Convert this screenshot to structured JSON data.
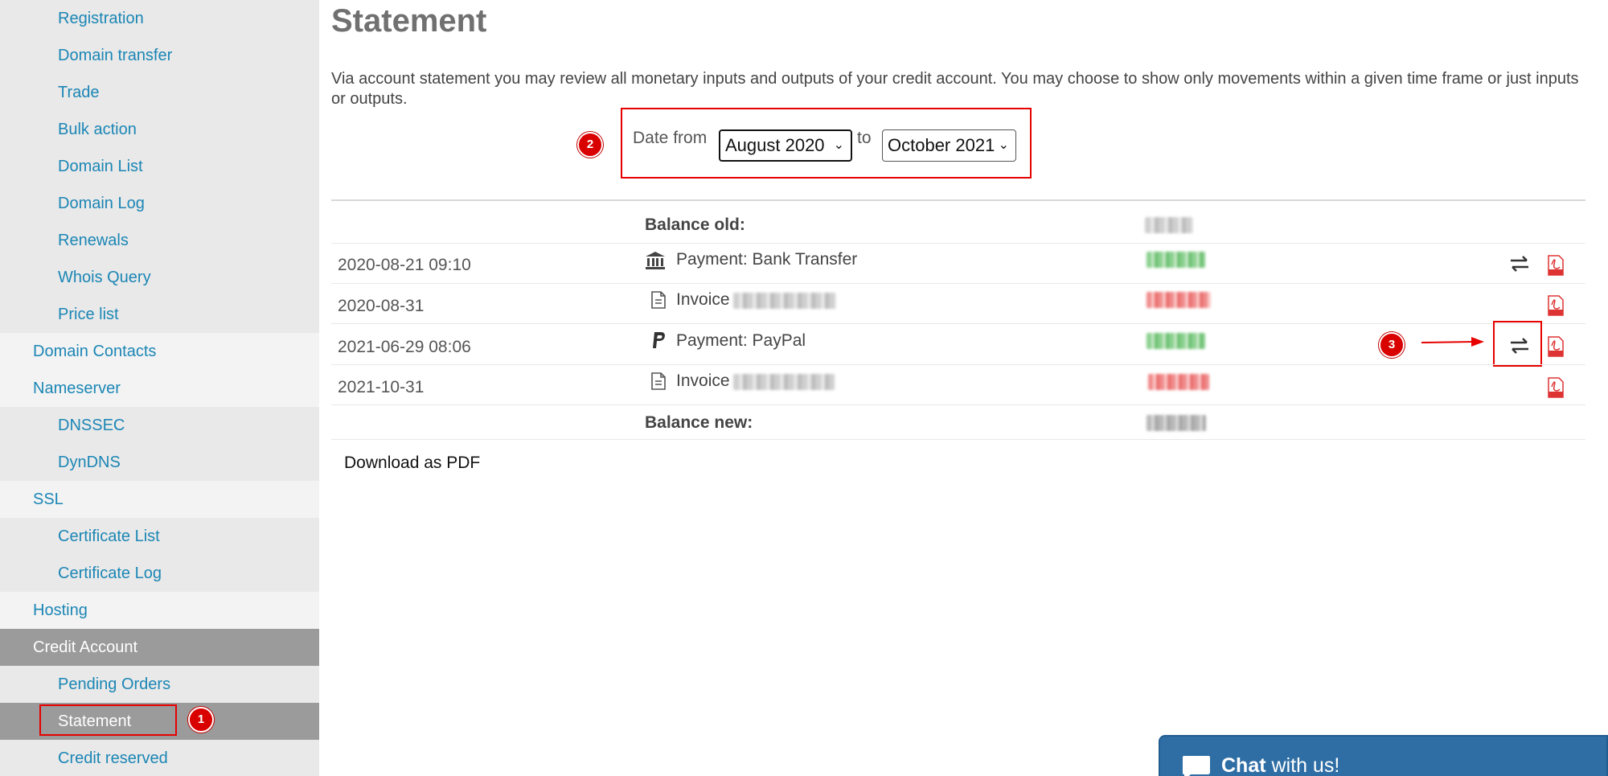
{
  "sidebar": {
    "items": [
      {
        "label": "Registration"
      },
      {
        "label": "Domain transfer"
      },
      {
        "label": "Trade"
      },
      {
        "label": "Bulk action"
      },
      {
        "label": "Domain List"
      },
      {
        "label": "Domain Log"
      },
      {
        "label": "Renewals"
      },
      {
        "label": "Whois Query"
      },
      {
        "label": "Price list"
      },
      {
        "label": "Domain Contacts"
      },
      {
        "label": "Nameserver"
      },
      {
        "label": "DNSSEC"
      },
      {
        "label": "DynDNS"
      },
      {
        "label": "SSL"
      },
      {
        "label": "Certificate List"
      },
      {
        "label": "Certificate Log"
      },
      {
        "label": "Hosting"
      },
      {
        "label": "Credit Account"
      },
      {
        "label": "Pending Orders"
      },
      {
        "label": "Statement"
      },
      {
        "label": "Credit reserved"
      }
    ]
  },
  "markers": {
    "one": "1",
    "two": "2",
    "three": "3"
  },
  "main": {
    "title": "Statement",
    "intro": "Via account statement you may review all monetary inputs and outputs of your credit account. You may choose to show only movements within a given time frame or just inputs or outputs.",
    "filter": {
      "date_from_label": "Date from",
      "from_value": "August 2020",
      "to_label": "to",
      "to_value": "October 2021"
    },
    "table": {
      "balance_old_label": "Balance old:",
      "balance_new_label": "Balance new:",
      "rows": [
        {
          "date": "2020-08-21 09:10",
          "icon": "bank-icon",
          "description": "Payment: Bank Transfer",
          "amount_color": "green",
          "has_transfer": true,
          "has_pdf": true
        },
        {
          "date": "2020-08-31",
          "icon": "document-icon",
          "description": "Invoice",
          "amount_color": "red",
          "has_transfer": false,
          "has_pdf": true
        },
        {
          "date": "2021-06-29 08:06",
          "icon": "paypal-icon",
          "description": "Payment: PayPal",
          "amount_color": "green",
          "has_transfer": true,
          "has_pdf": true
        },
        {
          "date": "2021-10-31",
          "icon": "document-icon",
          "description": "Invoice",
          "amount_color": "red",
          "has_transfer": false,
          "has_pdf": true
        }
      ]
    },
    "download_label": "Download as PDF"
  },
  "chat": {
    "bold": "Chat",
    "rest": " with us!"
  },
  "colors": {
    "link": "#1b86b5",
    "active_bg": "#9b9b9b",
    "highlight": "#e60000",
    "chat_bg": "#2f6ea5"
  }
}
